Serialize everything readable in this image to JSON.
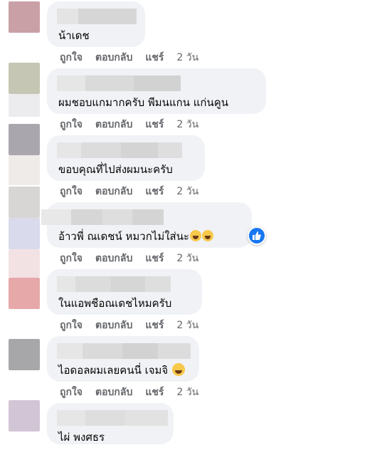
{
  "comments": [
    {
      "text": "น้าเดช",
      "actions": {
        "like": "ถูกใจ",
        "reply": "ตอบกลับ",
        "share": "แชร์",
        "time": "2 วัน"
      },
      "avatar_colors": [
        "#c9a0a5",
        "#c9a0a5",
        "#f4e9ea"
      ]
    },
    {
      "text": "ผมชอบแกมากครับ พีมนแกน แก่นคูน",
      "actions": {
        "like": "ถูกใจ",
        "reply": "ตอบกลับ",
        "share": "แชร์",
        "time": "2 วัน"
      },
      "avatar_colors": [
        "#c6c6b4",
        "#dadad3",
        "#eeeeee"
      ]
    },
    {
      "text": "ขอบคุณที่ไปส่งผมนะครับ",
      "actions": {
        "like": "ถูกใจ",
        "reply": "ตอบกลับ",
        "share": "แชร์",
        "time": "2 วัน"
      },
      "avatar_colors": [
        "#aaa6ae",
        "#b8b4bc",
        "#eeebe8"
      ]
    },
    {
      "text": "อ้าวพี่ ณเดชน์ หมวกไม่ใส่นะ",
      "emoji": [
        "grin-icon",
        "grin-icon"
      ],
      "reaction": "like-icon",
      "avatar_colors": [
        "#d8d6d4",
        "#ccd0e2",
        "#e3e0ef"
      ]
    },
    {
      "text": "ในแอพชือณเดชไหมครับ",
      "actions": {
        "like": "ถูกใจ",
        "reply": "ตอบกลับ",
        "share": "แชร์",
        "time": "2 วัน"
      },
      "avatar_colors": [
        "#f3e2e4",
        "#e3a2a5",
        "#e6a8a9"
      ]
    },
    {
      "text": "ไอดอลผมเลยคนนี่ เจมจิ",
      "emoji": [
        "laughing-icon"
      ],
      "actions": {
        "like": "ถูกใจ",
        "reply": "ตอบกลับ",
        "share": "แชร์",
        "time": "2 วัน"
      },
      "avatar_colors": [
        "#a3a3a6",
        "#aeaeb1",
        "#f0f0f1"
      ]
    },
    {
      "text": "ไผ่ พงศธร",
      "avatar_colors": [
        "#cec0d2",
        "#ddd2e1",
        "#f2f0f3"
      ]
    }
  ],
  "reply_actions_2": {
    "like": "ถูกใจ",
    "reply": "ตอบกลับ",
    "share": "แชร์",
    "time": "2 วัน"
  },
  "reply_actions_3": {
    "like": "ถูกใจ",
    "reply": "ตอบกลับ",
    "share": "แชร์",
    "time": "2 วัน"
  },
  "colors": {
    "bubble": "#f0f2f5",
    "meta": "#65676b",
    "like_blue": "#1877f2"
  }
}
